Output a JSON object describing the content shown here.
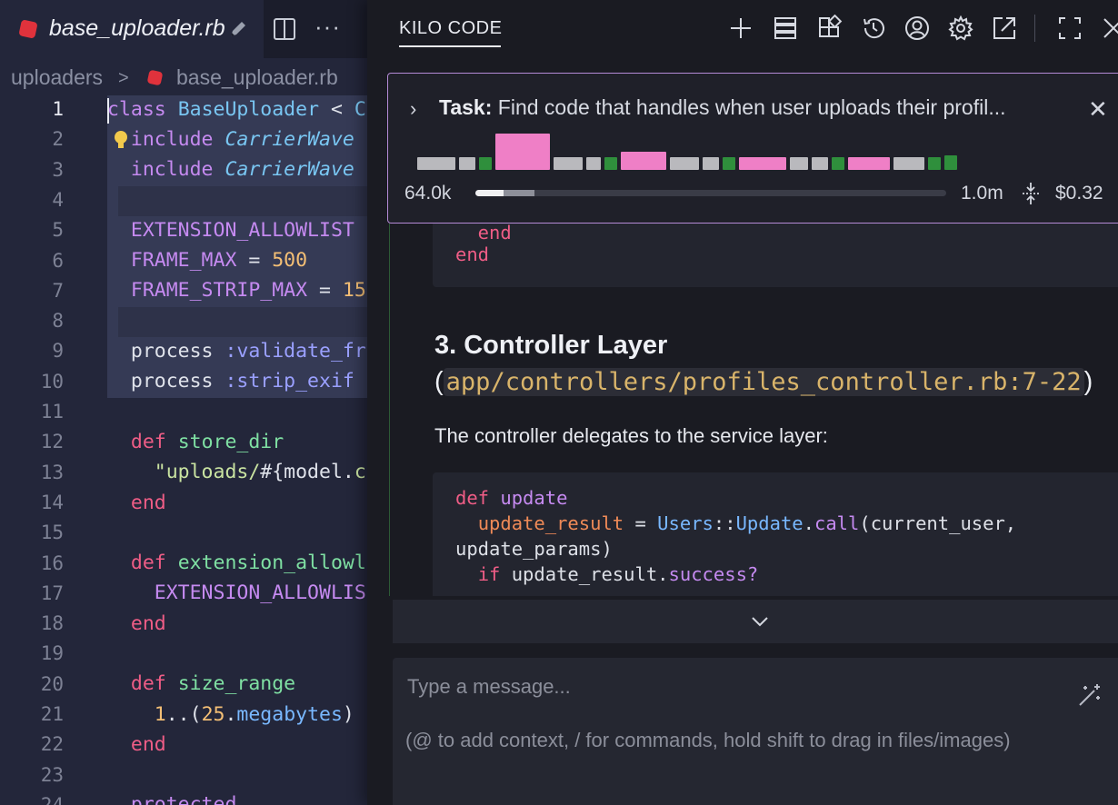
{
  "editor": {
    "tab_title": "base_uploader.rb",
    "tab_icons": [
      "pencil-icon",
      "split-editor-icon",
      "more-icon"
    ],
    "more_glyph": "···",
    "breadcrumb": {
      "folder": "uploaders",
      "separator": ">",
      "file": "base_uploader.rb"
    },
    "line_numbers": [
      "1",
      "2",
      "3",
      "4",
      "5",
      "6",
      "7",
      "8",
      "9",
      "10",
      "11",
      "12",
      "13",
      "14",
      "15",
      "16",
      "17",
      "18",
      "19",
      "20",
      "21",
      "22",
      "23",
      "24"
    ]
  },
  "panel": {
    "title": "KILO CODE",
    "toolbar_icons": [
      "plus-icon",
      "prompts-icon",
      "mcp-servers-icon",
      "history-icon",
      "account-icon",
      "settings-icon",
      "open-in-editor-icon",
      "fullscreen-icon",
      "close-icon"
    ],
    "task": {
      "label": "Task:",
      "text": "Find code that handles when user uploads their profil...",
      "close_glyph": "✕",
      "expand_glyph": "›",
      "tokens": "64.0k",
      "context_limit": "1.0m",
      "cost": "$0.32",
      "context_used_fraction": 0.06,
      "chip_colors": {
        "grey": "#b9b9bd",
        "pink": "#ef7fc6",
        "green": "#2f8f3c"
      }
    },
    "chat": {
      "top_code": [
        "  end",
        "end"
      ],
      "heading": "3. Controller Layer",
      "heading_open_paren": "(",
      "heading_path": "app/controllers/profiles_controller.rb:7-22",
      "heading_close_paren": ")",
      "paragraph": "The controller delegates to the service layer:",
      "code": {
        "l1_kw": "def",
        "l1_name": "update",
        "l2_var": "update_result",
        "l2_eq": " = ",
        "l2_mod": "Users",
        "l2_sep": "::",
        "l2_cls": "Update",
        "l2_dot": ".",
        "l2_call": "call",
        "l2_args": "(current_user,",
        "l3": "update_params)",
        "l4_kw": "if",
        "l4_obj": " update_result.",
        "l4_meth": "success?"
      }
    },
    "scroll_down_icon": "chevron-down-icon",
    "input": {
      "placeholder": "Type a message...",
      "hint": "(@ to add context, / for commands, hold shift to drag in files/images)"
    }
  }
}
